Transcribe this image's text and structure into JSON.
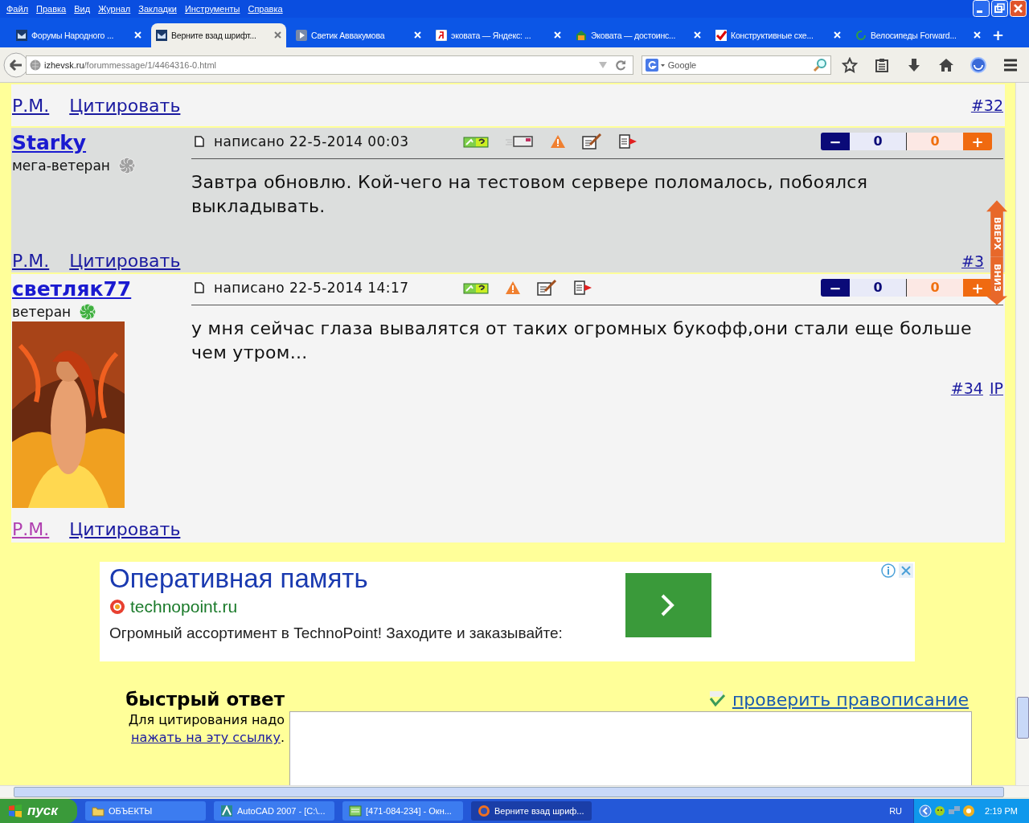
{
  "window": {
    "menu": [
      "Файл",
      "Правка",
      "Вид",
      "Журнал",
      "Закладки",
      "Инструменты",
      "Справка"
    ]
  },
  "tabs": [
    {
      "title": "Форумы Народного ...",
      "kind": "forum",
      "selected": false
    },
    {
      "title": "Верните взад шрифт...",
      "kind": "forum",
      "selected": true
    },
    {
      "title": "Светик Аввакумова",
      "kind": "video",
      "selected": false
    },
    {
      "title": "эковата — Яндекс: ...",
      "kind": "search",
      "selected": false
    },
    {
      "title": "Эковата — достоинс...",
      "kind": "home",
      "selected": false
    },
    {
      "title": "Конструктивные схе...",
      "kind": "check",
      "selected": false
    },
    {
      "title": "Велосипеды Forward...",
      "kind": "loading",
      "selected": false
    }
  ],
  "new_tab": "+",
  "address": {
    "host": "izhevsk.ru",
    "path": "/forummessage/1/4464316-0.html"
  },
  "search": {
    "placeholder": "Google"
  },
  "prev_footer": {
    "pm": "Р.М.",
    "quote": "Цитировать",
    "number": "#32",
    "pm_visited": false
  },
  "posts": [
    {
      "author": "Starky",
      "rank": "мега-ветеран",
      "color": "#a0a0a0",
      "meta": "написано 22-5-2014 00:03",
      "mail_icon": true,
      "minus": "−",
      "down": "0",
      "up": "0",
      "plus": "+",
      "text": "Завтра обновлю. Кой-чего на тестовом сервере поломалось, побоялся выкладывать.",
      "pm": "Р.М.",
      "quote": "Цитировать",
      "pm_visited": false,
      "number": "#3"
    },
    {
      "author": "светляк77",
      "rank": "ветеран",
      "color": "#40b040",
      "meta": "написано 22-5-2014 14:17",
      "mail_icon": false,
      "minus": "−",
      "down": "0",
      "up": "0",
      "plus": "+",
      "text": "у мня сейчас глаза вывалятся от таких огромных букофф,они стали еще больше чем утром...",
      "number": "#34",
      "ip": "IP",
      "pm": "Р.М.",
      "quote": "Цитировать",
      "pm_visited": true
    }
  ],
  "scroll_buttons": {
    "up": "ВВЕРХ",
    "down": "ВНИЗ"
  },
  "ad": {
    "title": "Оперативная память",
    "domain": "technopoint.ru",
    "text": "Огромный ассортимент в TechnoPoint! Заходите и заказывайте:"
  },
  "quick_reply": {
    "title": "быстрый ответ",
    "hint": "Для цитирования надо",
    "link": "нажать на эту ссылку",
    "period": ".",
    "spellcheck": "проверить правописание"
  },
  "taskbar": {
    "start": "пуск",
    "items": [
      {
        "label": "ОБЪЕКТЫ",
        "kind": "folder",
        "selected": false
      },
      {
        "label": "AutoCAD 2007 - [C:\\...",
        "kind": "cad",
        "selected": false
      },
      {
        "label": "[471-084-234] - Окн...",
        "kind": "sheet",
        "selected": false
      },
      {
        "label": "Верните взад шриф...",
        "kind": "browser",
        "selected": true
      }
    ],
    "lang": "RU",
    "clock": "2:19 PM"
  }
}
